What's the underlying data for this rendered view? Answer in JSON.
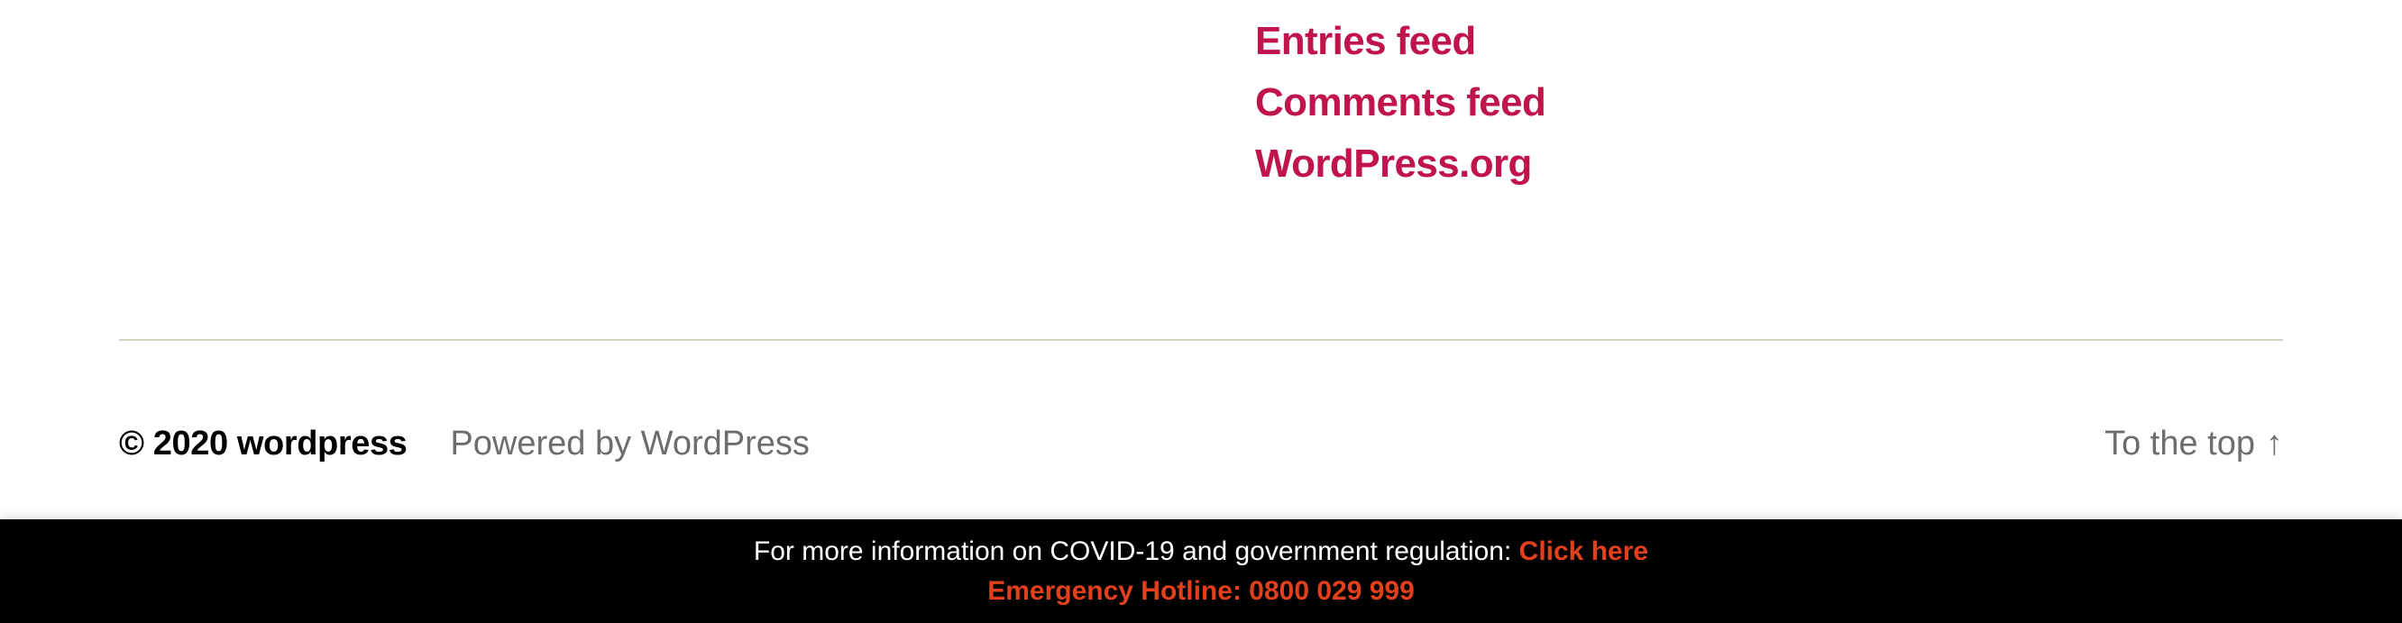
{
  "meta_widget": {
    "links": [
      {
        "label": "Entries feed"
      },
      {
        "label": "Comments feed"
      },
      {
        "label": "WordPress.org"
      }
    ]
  },
  "footer": {
    "copyright": "© 2020 wordpress",
    "powered_by": "Powered by WordPress",
    "to_top_label": "To the top",
    "to_top_arrow": "↑"
  },
  "covid_bar": {
    "info_text": "For more information on COVID-19 and government regulation: ",
    "link_label": "Click here",
    "hotline": "Emergency Hotline: 0800 029 999"
  },
  "colors": {
    "accent": "#c0154a",
    "covid_accent": "#e2401c",
    "divider": "#d4d1c2",
    "muted_text": "#6d6d6d"
  }
}
